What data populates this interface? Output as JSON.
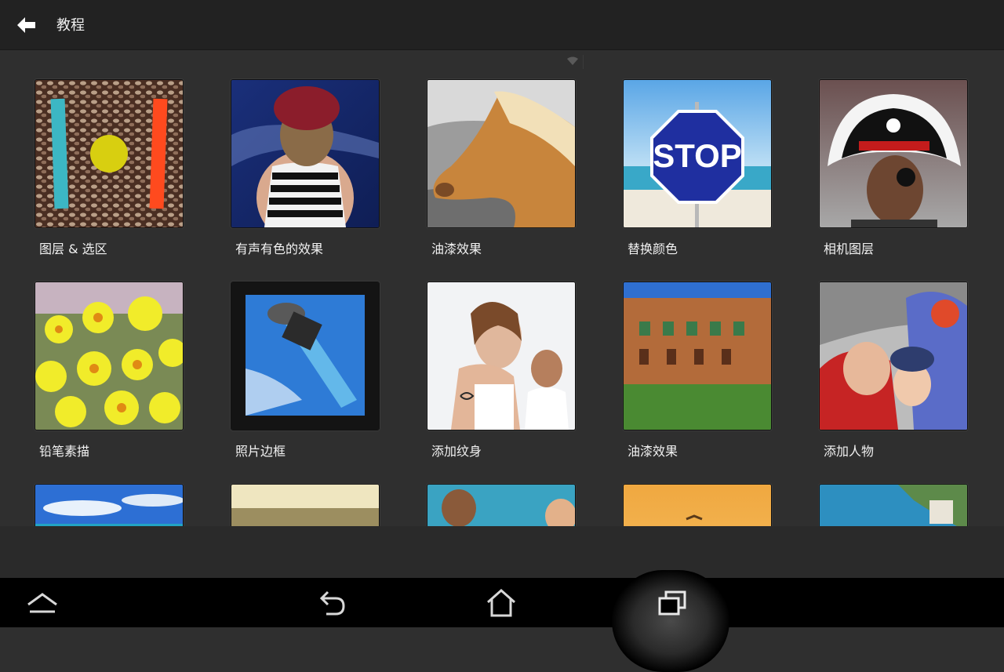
{
  "header": {
    "title": "教程",
    "back_icon": "back-arrow-icon"
  },
  "tutorials": [
    {
      "label": "图层 & 选区"
    },
    {
      "label": "有声有色的效果"
    },
    {
      "label": "油漆效果"
    },
    {
      "label": "替换颜色"
    },
    {
      "label": "相机图层"
    },
    {
      "label": "铅笔素描"
    },
    {
      "label": "照片边框"
    },
    {
      "label": "添加纹身"
    },
    {
      "label": "油漆效果"
    },
    {
      "label": "添加人物"
    }
  ],
  "stop_sign_text": "STOP",
  "nav": {
    "icons": [
      "up-chevron-icon",
      "back-icon",
      "home-icon",
      "recents-icon"
    ]
  },
  "colors": {
    "background": "#2f2f2f",
    "topbar": "#222222",
    "navbar": "#000000"
  }
}
